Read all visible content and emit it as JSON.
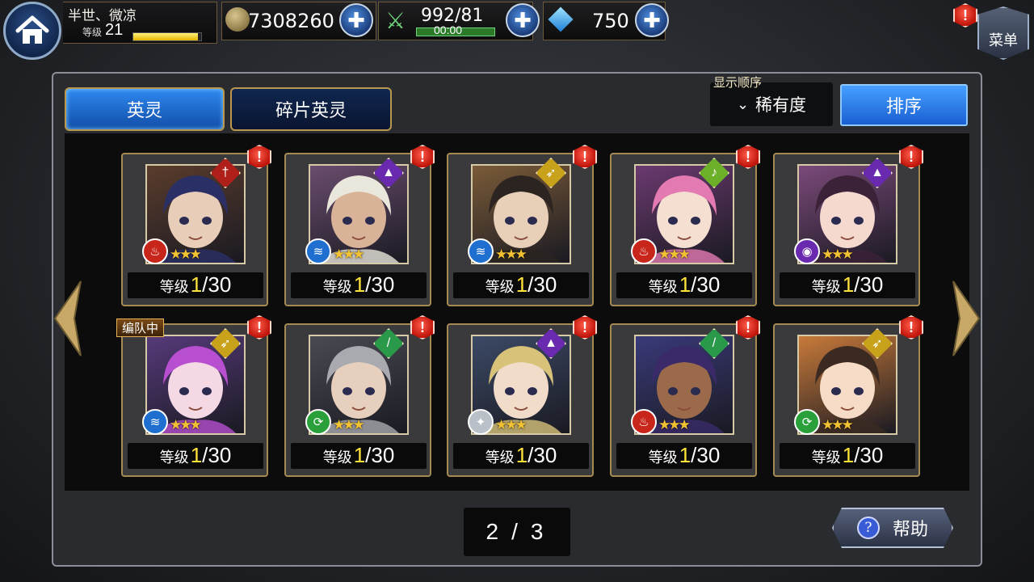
{
  "player": {
    "name": "半世、微凉",
    "level_label": "等级",
    "level": "21",
    "exp_fraction": 0.95
  },
  "resources": {
    "gold": "7308260",
    "stamina": "992/81",
    "stamina_timer": "00:00",
    "gems": "750"
  },
  "menu": {
    "label": "菜单"
  },
  "tabs": [
    {
      "label": "英灵",
      "active": true
    },
    {
      "label": "碎片英灵",
      "active": false
    }
  ],
  "sort": {
    "caption": "显示顺序",
    "current": "稀有度",
    "button_label": "排序"
  },
  "heroes": [
    {
      "level_label": "等级",
      "level": "1",
      "max": "/30",
      "element": "fire",
      "class": "sword",
      "stars": 3,
      "team": "",
      "hair": "#2a2f66",
      "skin": "#e8cdb8",
      "bg": "#5a3c2c"
    },
    {
      "level_label": "等级",
      "level": "1",
      "max": "/30",
      "element": "water",
      "class": "mage",
      "stars": 3,
      "team": "",
      "hair": "#e9e6dc",
      "skin": "#d9b397",
      "bg": "#6a4d6e"
    },
    {
      "level_label": "等级",
      "level": "1",
      "max": "/30",
      "element": "water",
      "class": "bow",
      "stars": 3,
      "team": "",
      "hair": "#2b2420",
      "skin": "#e8cfb8",
      "bg": "#7a5b38"
    },
    {
      "level_label": "等级",
      "level": "1",
      "max": "/30",
      "element": "fire",
      "class": "staff",
      "stars": 3,
      "team": "",
      "hair": "#e37ab1",
      "skin": "#f5dfd0",
      "bg": "#6b3a70"
    },
    {
      "level_label": "等级",
      "level": "1",
      "max": "/30",
      "element": "dark",
      "class": "mage",
      "stars": 3,
      "team": "",
      "hair": "#3b2238",
      "skin": "#f5d9cf",
      "bg": "#7b4a7a"
    },
    {
      "level_label": "等级",
      "level": "1",
      "max": "/30",
      "element": "water",
      "class": "bow",
      "stars": 3,
      "team": "编队中",
      "hair": "#b74fd0",
      "skin": "#f4d8e4",
      "bg": "#563a7a"
    },
    {
      "level_label": "等级",
      "level": "1",
      "max": "/30",
      "element": "wind",
      "class": "blade",
      "stars": 3,
      "team": "",
      "hair": "#a9aaaf",
      "skin": "#e7cfbd",
      "bg": "#4a4a52"
    },
    {
      "level_label": "等级",
      "level": "1",
      "max": "/30",
      "element": "light",
      "class": "mage",
      "stars": 3,
      "team": "",
      "hair": "#d8c27a",
      "skin": "#f1dcc9",
      "bg": "#3c4a66"
    },
    {
      "level_label": "等级",
      "level": "1",
      "max": "/30",
      "element": "fire",
      "class": "blade",
      "stars": 3,
      "team": "",
      "hair": "#3a2a6a",
      "skin": "#9b6a4a",
      "bg": "#3a3a7a"
    },
    {
      "level_label": "等级",
      "level": "1",
      "max": "/30",
      "element": "wind",
      "class": "bow",
      "stars": 3,
      "team": "",
      "hair": "#3b2a22",
      "skin": "#f6dcc6",
      "bg": "#c87a3a"
    }
  ],
  "pagination": {
    "current": "2",
    "separator": "/",
    "total": "3"
  },
  "help": {
    "label": "帮助"
  },
  "colors": {
    "accent_blue": "#1a5fd2",
    "alert_red": "#c0150b",
    "star_gold": "#f2c233",
    "level_yellow": "#ffe23a"
  }
}
